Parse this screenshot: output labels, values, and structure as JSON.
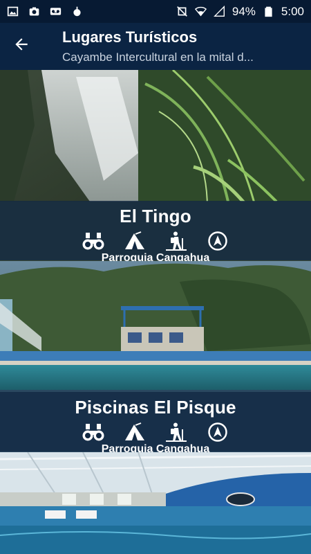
{
  "status_bar": {
    "battery": "94%",
    "time": "5:00",
    "icons_left": [
      "image-icon",
      "camera-icon",
      "voicemail-icon",
      "drop-icon"
    ],
    "icons_right": [
      "mute-icon",
      "wifi-icon",
      "signal-icon"
    ]
  },
  "app_bar": {
    "title": "Lugares Turísticos",
    "subtitle": "Cayambe Intercultural en la mital d..."
  },
  "places": [
    {
      "name": "El Tingo",
      "parish": "Parroquia Cangahua",
      "icons": [
        "binoculars-icon",
        "camping-icon",
        "hiking-icon",
        "navigation-icon"
      ]
    },
    {
      "name": "Piscinas El Pisque",
      "parish": "Parroquia Cangahua",
      "icons": [
        "binoculars-icon",
        "camping-icon",
        "hiking-icon",
        "navigation-icon"
      ]
    },
    {
      "name": "",
      "parish": ""
    }
  ],
  "colors": {
    "status_bar": "#071a33",
    "app_bar": "#0b2443",
    "card_overlay": "#122842"
  }
}
